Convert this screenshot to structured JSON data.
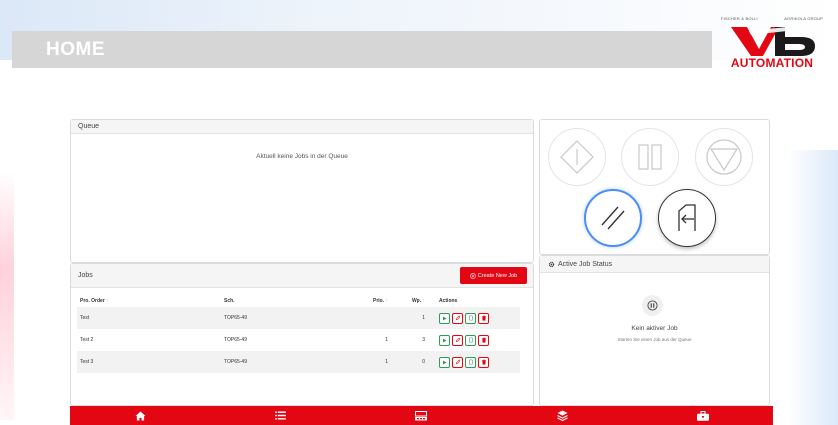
{
  "header": {
    "title": "HOME"
  },
  "logo": {
    "top_left_text": "FISCHER & BOLLI",
    "top_right_text": "AGRIKOLA GROUP",
    "caption": "AUTOMATION",
    "brand_red": "#e30613"
  },
  "queue": {
    "title": "Queue",
    "empty_message": "Aktuell keine Jobs in der Queue"
  },
  "jobs": {
    "title": "Jobs",
    "create_button": "Create New Job",
    "columns": {
      "order": "Pro. Order",
      "sch": "Sch.",
      "prio": "Prio.",
      "wp": "Wp.",
      "actions": "Actions"
    },
    "rows": [
      {
        "order": "Test",
        "sch": "TOP65-49",
        "prio": "",
        "wp": "1"
      },
      {
        "order": "Test 2",
        "sch": "TOP65-49",
        "prio": "1",
        "wp": "3"
      },
      {
        "order": "Test 3",
        "sch": "TOP65-49",
        "prio": "1",
        "wp": "0"
      }
    ]
  },
  "controls": {
    "buttons": [
      "start",
      "pause",
      "stop",
      "reset",
      "exit"
    ]
  },
  "status": {
    "title": "Active Job Status",
    "heading": "Kein aktiver Job",
    "subtext": "Starten Sie einen Job aus der Queue"
  },
  "nav": {
    "items": [
      "home-icon",
      "list-icon",
      "machine-icon",
      "layers-icon",
      "toolbox-icon"
    ]
  },
  "colors": {
    "accent_red": "#e30613",
    "success_green": "#2e9b5a",
    "focus_blue": "#4b8df8"
  }
}
